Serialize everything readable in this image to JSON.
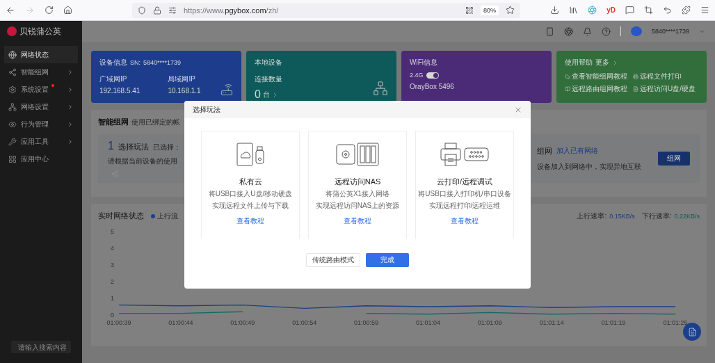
{
  "browser": {
    "url": {
      "prefix": "https://www.",
      "host": "pgybox.com",
      "path": "/zh/"
    },
    "zoom": "80%",
    "extension_label": "yD"
  },
  "header": {
    "account": "5840****1739"
  },
  "sidebar": {
    "brand": "贝锐蒲公英",
    "items": [
      {
        "label": "网络状态",
        "selected": true,
        "expandable": false,
        "alert": false
      },
      {
        "label": "智能组网",
        "selected": false,
        "expandable": true,
        "alert": false
      },
      {
        "label": "系统设置",
        "selected": false,
        "expandable": true,
        "alert": true
      },
      {
        "label": "网络设置",
        "selected": false,
        "expandable": true,
        "alert": false
      },
      {
        "label": "行为管理",
        "selected": false,
        "expandable": true,
        "alert": false
      },
      {
        "label": "应用工具",
        "selected": false,
        "expandable": true,
        "alert": false
      },
      {
        "label": "应用中心",
        "selected": false,
        "expandable": false,
        "alert": false
      }
    ],
    "search": {
      "placeholder": "请输入搜索内容"
    }
  },
  "cards": [
    {
      "kind": "device",
      "color": "#1d3d8c",
      "title": "设备信息",
      "sn_label": "SN:",
      "sn": "5840****1739",
      "fields": [
        {
          "label": "广域网IP",
          "value": "192.168.5.41"
        },
        {
          "label": "局域网IP",
          "value": "10.168.1.1"
        }
      ]
    },
    {
      "kind": "local",
      "color": "#0e5a5a",
      "title": "本地设备",
      "label": "连接数量",
      "count": "0",
      "unit": "台"
    },
    {
      "kind": "wifi",
      "color": "#4b2b78",
      "title": "WiFi信息",
      "band": "2.4G",
      "on": true,
      "ssid": "OrayBox 5496"
    },
    {
      "kind": "help",
      "color": "#326e3c",
      "title": "使用帮助",
      "more": "更多",
      "links": [
        "查看智能组网教程",
        "远程文件打印",
        "远程路由组网教程",
        "远程访问U盘/硬盘"
      ]
    }
  ],
  "smart_network": {
    "title": "智能组网",
    "subtitle": "使用已绑定的帐",
    "step_number": "1",
    "step_title": "选择玩法",
    "step_selected": "已选择：",
    "step_desc": "请根据当前设备的使用",
    "join_title": "组网",
    "join_link": "加入已有网络",
    "join_desc": "设备加入到网络中，实现异地互联",
    "join_button": "组网"
  },
  "realtime": {
    "title": "实时网络状态",
    "legend": "上行流",
    "up_label": "上行速率:",
    "up_value": "0.15KB/s",
    "down_label": "下行速率:",
    "down_value": "0.22KB/s",
    "chart_data": {
      "type": "line",
      "categories": [
        "01:00:39",
        "01:00:44",
        "01:00:49",
        "01:00:54",
        "01:00:59",
        "01:01:04",
        "01:01:09",
        "01:01:14",
        "01:01:19",
        "01:01:25"
      ],
      "ylim": [
        0,
        5
      ],
      "yticks": [
        0,
        1,
        2,
        3,
        4,
        5
      ],
      "series": [
        {
          "color": "#1e3f8a",
          "values": [
            0.6,
            0.55,
            0.6,
            0.4,
            0.55,
            0.5,
            0.55,
            0.45,
            0.5,
            0.5
          ]
        },
        {
          "color": "#136b63",
          "values": [
            0.1,
            0.1,
            0.2,
            null,
            0.1,
            0.05,
            0.15,
            0.05,
            0.1,
            0.05
          ]
        }
      ]
    }
  },
  "modal": {
    "title": "选择玩法",
    "options": [
      {
        "kind": "cloud",
        "title": "私有云",
        "lines": [
          "将USB口接入U盘/移动硬盘",
          "实现远程文件上传与下载"
        ],
        "link": "查看教程"
      },
      {
        "kind": "nas",
        "title": "远程访问NAS",
        "lines": [
          "将蒲公英X1接入网络",
          "实现远程访问NAS上的资源"
        ],
        "link": "查看教程"
      },
      {
        "kind": "print",
        "title": "云打印/远程调试",
        "lines": [
          "将USB口接入打印机/串口设备",
          "实现远程打印/远程运维"
        ],
        "link": "查看教程"
      }
    ],
    "buttons": [
      {
        "label": "传统路由模式",
        "primary": false
      },
      {
        "label": "完成",
        "primary": true
      }
    ]
  }
}
